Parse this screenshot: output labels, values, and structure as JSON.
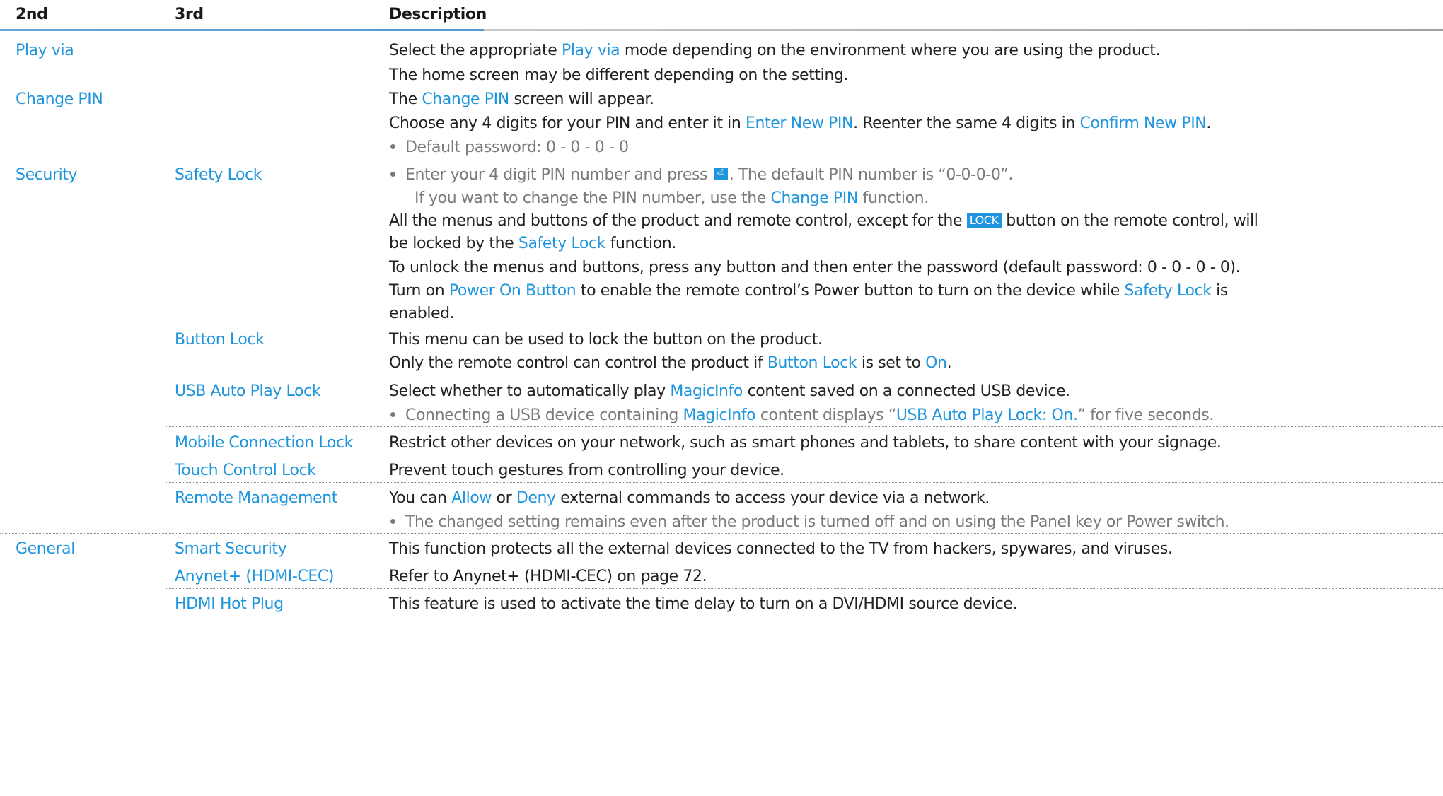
{
  "header": {
    "col1": "2nd",
    "col2": "3rd",
    "col3": "Description"
  },
  "play_via": {
    "label": "Play via",
    "d1a": "Select the appropriate ",
    "d1b": "Play via",
    "d1c": " mode depending on the environment where you are using the product.",
    "d2": "The home screen may be different depending on the setting."
  },
  "change_pin": {
    "label": "Change PIN",
    "d1a": "The ",
    "d1b": "Change PIN",
    "d1c": " screen will appear.",
    "d2a": "Choose any 4 digits for your PIN and enter it in ",
    "d2b": "Enter New PIN",
    "d2c": ". Reenter the same 4 digits in ",
    "d2d": "Confirm New PIN",
    "d2e": ".",
    "d3": "Default password: 0 - 0 - 0 - 0"
  },
  "security": {
    "label": "Security",
    "safety_lock": {
      "label": "Safety Lock",
      "b1a": "Enter your 4 digit PIN number and press ",
      "b1b": ". The default PIN number is “0-0-0-0”.",
      "b2a": "If you want to change the PIN number, use the ",
      "b2b": "Change PIN",
      "b2c": " function.",
      "p1a": "All the menus and buttons of the product and remote control, except for the ",
      "lock_key": "LOCK",
      "p1b": " button on the remote control, will",
      "p2a": "be locked by the ",
      "p2b": "Safety Lock",
      "p2c": " function.",
      "p3": "To unlock the menus and buttons, press any button and then enter the password (default password: 0 - 0 - 0 - 0).",
      "p4a": "Turn on ",
      "p4b": "Power On Button",
      "p4c": " to enable the remote control’s Power button to turn on the device while ",
      "p4d": "Safety Lock",
      "p4e": " is",
      "p5": "enabled."
    },
    "button_lock": {
      "label": "Button Lock",
      "d1": "This menu can be used to lock the button on the product.",
      "d2a": "Only the remote control can control the product if ",
      "d2b": "Button Lock",
      "d2c": " is set to ",
      "d2d": "On",
      "d2e": "."
    },
    "usb_auto_play_lock": {
      "label": "USB Auto Play Lock",
      "d1a": "Select whether to automatically play ",
      "d1b": "MagicInfo",
      "d1c": " content saved on a connected USB device.",
      "d2a": "Connecting a USB device containing ",
      "d2b": "MagicInfo",
      "d2c": " content displays “",
      "d2d": "USB Auto Play Lock: On.",
      "d2e": "” for five seconds."
    },
    "mobile_connection_lock": {
      "label": "Mobile Connection Lock",
      "d1": "Restrict other devices on your network, such as smart phones and tablets, to share content with your signage."
    },
    "touch_control_lock": {
      "label": "Touch Control Lock",
      "d1": "Prevent touch gestures from controlling your device."
    },
    "remote_management": {
      "label": "Remote Management",
      "d1a": "You can ",
      "d1b": "Allow",
      "d1c": " or ",
      "d1d": "Deny",
      "d1e": " external commands to access your device via a network.",
      "d2": "The changed setting remains even after the product is turned off and on using the Panel key or Power switch."
    }
  },
  "general": {
    "label": "General",
    "smart_security": {
      "label": "Smart Security",
      "d1": "This function protects all the external devices connected to the TV from hackers, spywares, and viruses."
    },
    "anynet": {
      "label": "Anynet+ (HDMI-CEC)",
      "d1a": "Refer to ",
      "d1b": "Anynet+ (HDMI-CEC)",
      "d1c": " on page ",
      "d1d": "72",
      "d1e": "."
    },
    "hdmi_hot_plug": {
      "label": "HDMI Hot Plug",
      "d1": "This feature is used to activate the time delay to turn on a DVI/HDMI source device."
    }
  },
  "colors": {
    "accent": "#1f95dd",
    "header_bar_blue": "#4f9bd9",
    "header_bar_grey": "#a8a8a8"
  }
}
